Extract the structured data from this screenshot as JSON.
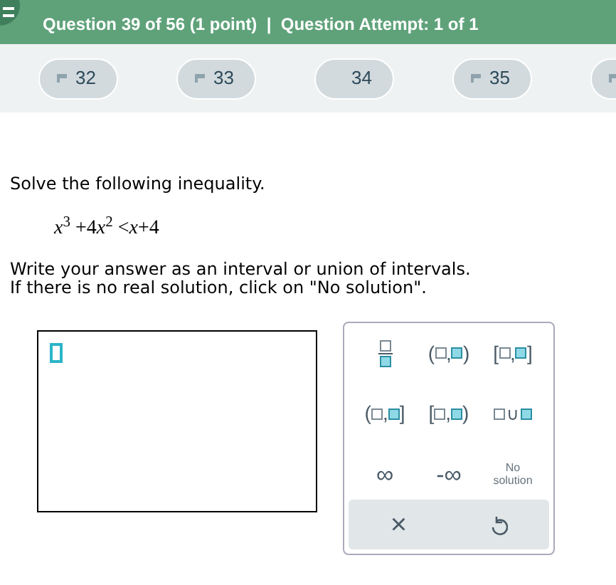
{
  "header": {
    "subtitle": "Question 39 of 56 (1 point)  |  Question Attempt: 1 of 1"
  },
  "question_nav": [
    {
      "label": "32",
      "flagged": true
    },
    {
      "label": "33",
      "flagged": true
    },
    {
      "label": "34",
      "flagged": false
    },
    {
      "label": "35",
      "flagged": true
    },
    {
      "flagged": true
    }
  ],
  "prompt": "Solve the following inequality.",
  "expression": [
    {
      "kind": "var",
      "text": "x"
    },
    {
      "kind": "sup",
      "text": "3"
    },
    {
      "kind": "op",
      "text": " +4"
    },
    {
      "kind": "var",
      "text": "x"
    },
    {
      "kind": "sup",
      "text": "2"
    },
    {
      "kind": "op",
      "text": " <"
    },
    {
      "kind": "var",
      "text": "x"
    },
    {
      "kind": "op",
      "text": "+4"
    }
  ],
  "instructions": [
    "Write your answer as an interval or union of intervals.",
    "If there is no real solution, click on \"No solution\"."
  ],
  "keypad": [
    {
      "kind": "fraction"
    },
    {
      "kind": "interval",
      "open": "(",
      "sep": ",",
      "close": ")"
    },
    {
      "kind": "interval",
      "open": "[",
      "sep": ",",
      "close": "]"
    },
    {
      "kind": "interval",
      "open": "(",
      "sep": ",",
      "close": "]"
    },
    {
      "kind": "interval",
      "open": "[",
      "sep": ",",
      "close": ")"
    },
    {
      "kind": "union",
      "symbol": "∪"
    },
    {
      "kind": "text",
      "text": "∞"
    },
    {
      "kind": "text",
      "text": "-∞"
    },
    {
      "kind": "small",
      "text": "No solution"
    }
  ],
  "actions": [
    {
      "kind": "clear",
      "text": "×"
    },
    {
      "kind": "undo"
    }
  ]
}
